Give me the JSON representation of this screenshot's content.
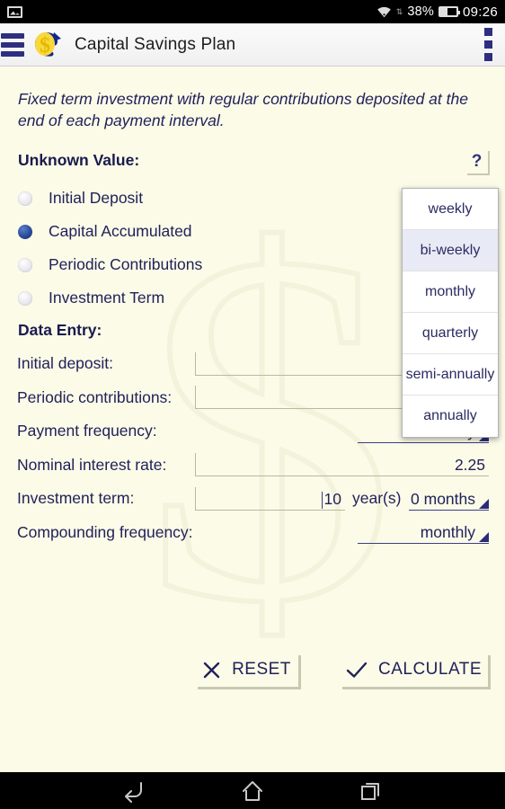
{
  "status_bar": {
    "photo_icon": "photo-icon",
    "wifi_icon": "wifi-icon",
    "data_arrows": "⇅",
    "battery_percent": "38%",
    "battery_icon": "battery-icon",
    "time": "09:26"
  },
  "app_bar": {
    "menu_icon": "hamburger-menu-icon",
    "logo_icon": "dollar-anchor-logo-icon",
    "title": "Capital Savings Plan",
    "overflow_icon": "overflow-menu-icon"
  },
  "main": {
    "description": "Fixed term investment with regular contributions deposited at the end of each payment interval.",
    "unknown_value_title": "Unknown Value:",
    "help_label": "?",
    "radio_options": [
      {
        "label": "Initial Deposit",
        "selected": false
      },
      {
        "label": "Capital Accumulated",
        "selected": true
      },
      {
        "label": "Periodic Contributions",
        "selected": false
      },
      {
        "label": "Investment Term",
        "selected": false
      }
    ],
    "data_entry_title": "Data Entry:",
    "fields": {
      "initial_deposit": {
        "label": "Initial deposit:",
        "value": ""
      },
      "periodic_contributions": {
        "label": "Periodic contributions:",
        "value": ""
      },
      "payment_frequency": {
        "label": "Payment frequency:",
        "value": "bi-weekly"
      },
      "nominal_interest_rate": {
        "label": "Nominal interest rate:",
        "value": "2.25"
      },
      "investment_term": {
        "label": "Investment term:",
        "years_value": "10",
        "years_unit": "year(s)",
        "months_value": "0 months"
      },
      "compounding_frequency": {
        "label": "Compounding frequency:",
        "value": "monthly"
      }
    },
    "buttons": {
      "reset_label": "RESET",
      "reset_icon": "close-x-icon",
      "calculate_label": "CALCULATE",
      "calculate_icon": "checkmark-icon"
    }
  },
  "dropdown": {
    "visible": true,
    "selected": "bi-weekly",
    "options": [
      "weekly",
      "bi-weekly",
      "monthly",
      "quarterly",
      "semi-annually",
      "annually"
    ]
  },
  "nav_bar": {
    "back_icon": "back-arrow-icon",
    "home_icon": "home-icon",
    "recents_icon": "recent-apps-icon"
  },
  "colors": {
    "background": "#fbfbe8",
    "text": "#21215a",
    "accent": "#2b2b7a",
    "radio_selected": "#2a4b9b"
  }
}
